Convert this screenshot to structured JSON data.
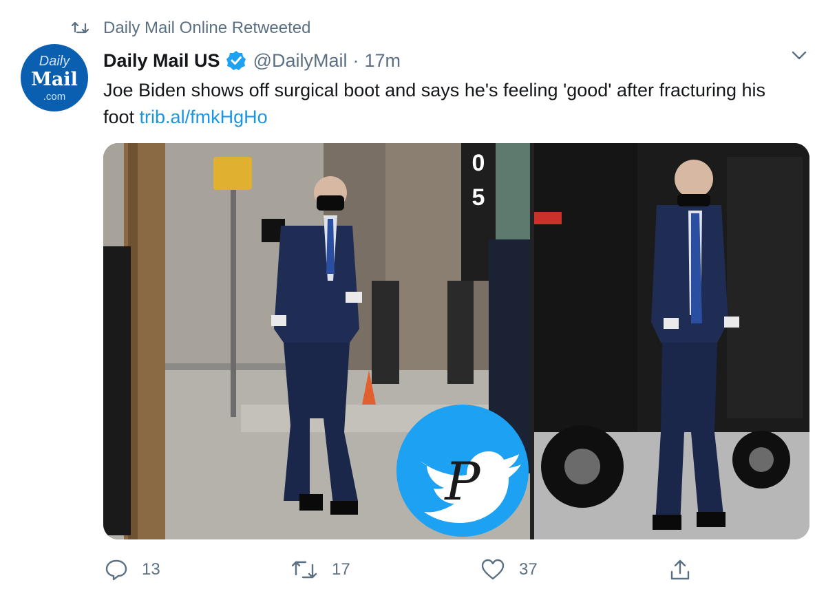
{
  "retweet": {
    "label": "Daily Mail Online Retweeted"
  },
  "avatar": {
    "line1": "Daily",
    "line2": "Mail",
    "line3": ".com"
  },
  "tweet": {
    "name": "Daily Mail US",
    "handle": "@DailyMail",
    "separator": "·",
    "time": "17m",
    "text": "Joe Biden shows off surgical boot and says he's feeling 'good' after fracturing his foot ",
    "link": "trib.al/fmkHgHo"
  },
  "photo": {
    "sign_top": "0",
    "sign_bottom": "5"
  },
  "watermark": {
    "letter": "P"
  },
  "actions": {
    "replies": "13",
    "retweets": "17",
    "likes": "37"
  },
  "colors": {
    "link": "#1b95e0",
    "verified": "#1da1f2",
    "muted": "#5b7083",
    "watermark": "#1da1f2"
  }
}
